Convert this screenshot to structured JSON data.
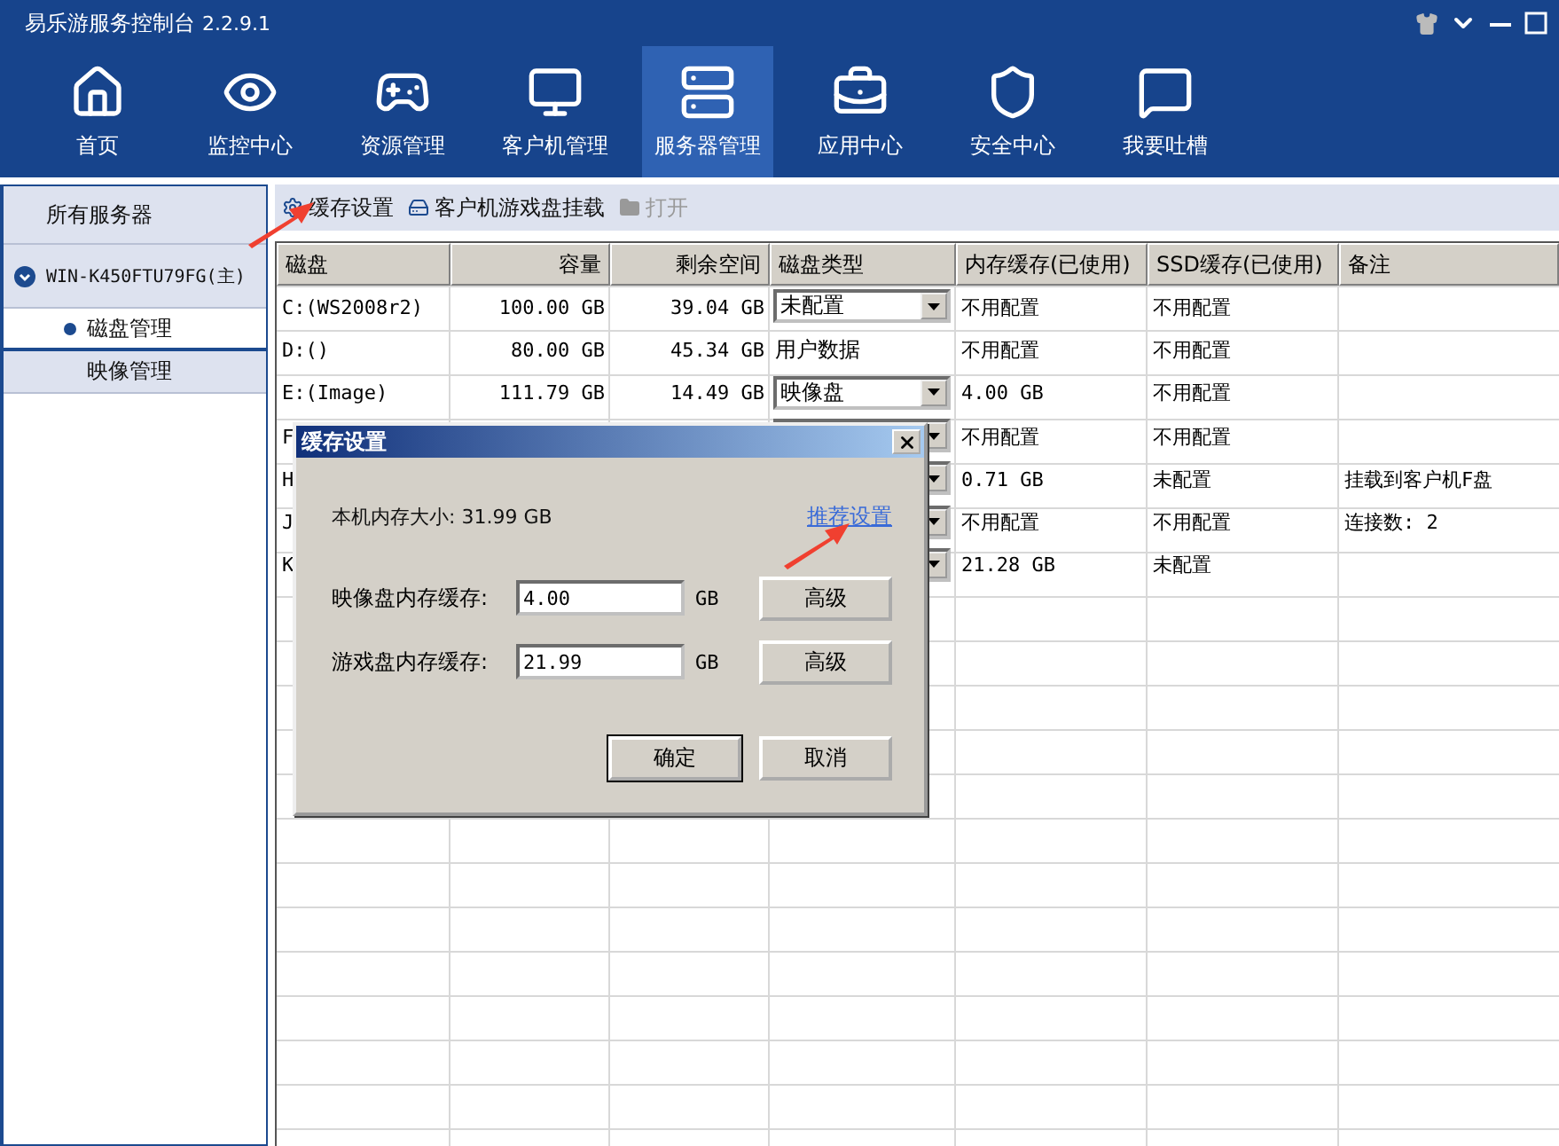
{
  "window": {
    "title": "易乐游服务控制台",
    "version": "2.2.9.1"
  },
  "nav": [
    {
      "label": "首页",
      "selected": false
    },
    {
      "label": "监控中心",
      "selected": false
    },
    {
      "label": "资源管理",
      "selected": false
    },
    {
      "label": "客户机管理",
      "selected": false
    },
    {
      "label": "服务器管理",
      "selected": true
    },
    {
      "label": "应用中心",
      "selected": false
    },
    {
      "label": "安全中心",
      "selected": false
    },
    {
      "label": "我要吐槽",
      "selected": false
    }
  ],
  "sidebar": {
    "root": "所有服务器",
    "server": {
      "label": "WIN-K450FTU79FG(主)",
      "expanded": true,
      "children": [
        {
          "label": "磁盘管理",
          "selected": true
        },
        {
          "label": "映像管理",
          "selected": false
        }
      ]
    }
  },
  "toolbar": [
    {
      "label": "缓存设置",
      "disabled": false
    },
    {
      "label": "客户机游戏盘挂载",
      "disabled": false
    },
    {
      "label": "打开",
      "disabled": true
    }
  ],
  "table": {
    "columns": [
      "磁盘",
      "容量",
      "剩余空间",
      "磁盘类型",
      "内存缓存(已使用)",
      "SSD缓存(已使用)",
      "备注"
    ],
    "rows": [
      {
        "disk": "C:(WS2008r2)",
        "capacity": "100.00 GB",
        "free": "39.04 GB",
        "type": {
          "kind": "dropdown",
          "value": "未配置"
        },
        "mem": "不用配置",
        "ssd": "不用配置"
      },
      {
        "disk": "D:()",
        "capacity": "80.00 GB",
        "free": "45.34 GB",
        "type": {
          "kind": "text",
          "value": "用户数据"
        },
        "mem": "不用配置",
        "ssd": "不用配置"
      },
      {
        "disk": "E:(Image)",
        "capacity": "111.79 GB",
        "free": "14.49 GB",
        "type": {
          "kind": "dropdown",
          "value": "映像盘"
        },
        "mem": "4.00 GB",
        "ssd": "不用配置"
      },
      {
        "disk": "F",
        "type": {
          "kind": "dropdown"
        },
        "mem": "不用配置",
        "ssd": "不用配置"
      },
      {
        "disk": "H",
        "type": {
          "kind": "dropdown"
        },
        "mem": "0.71 GB",
        "ssd": "未配置",
        "note": "挂载到客户机F盘"
      },
      {
        "disk": "J",
        "type": {
          "kind": "dropdown"
        },
        "mem": "不用配置",
        "ssd": "不用配置",
        "note": "连接数: 2"
      },
      {
        "disk": "K",
        "type": {
          "kind": "dropdown"
        },
        "mem": "21.28 GB",
        "ssd": "未配置"
      }
    ]
  },
  "dialog": {
    "title": "缓存设置",
    "memory_size": "本机内存大小: 31.99 GB",
    "link": "推荐设置",
    "fields": [
      {
        "label": "映像盘内存缓存:",
        "value": "4.00",
        "unit": "GB",
        "button": "高级"
      },
      {
        "label": "游戏盘内存缓存:",
        "value": "21.99",
        "unit": "GB",
        "button": "高级"
      }
    ],
    "buttons": [
      {
        "label": "确定",
        "default": true
      },
      {
        "label": "取消",
        "default": false
      }
    ]
  }
}
